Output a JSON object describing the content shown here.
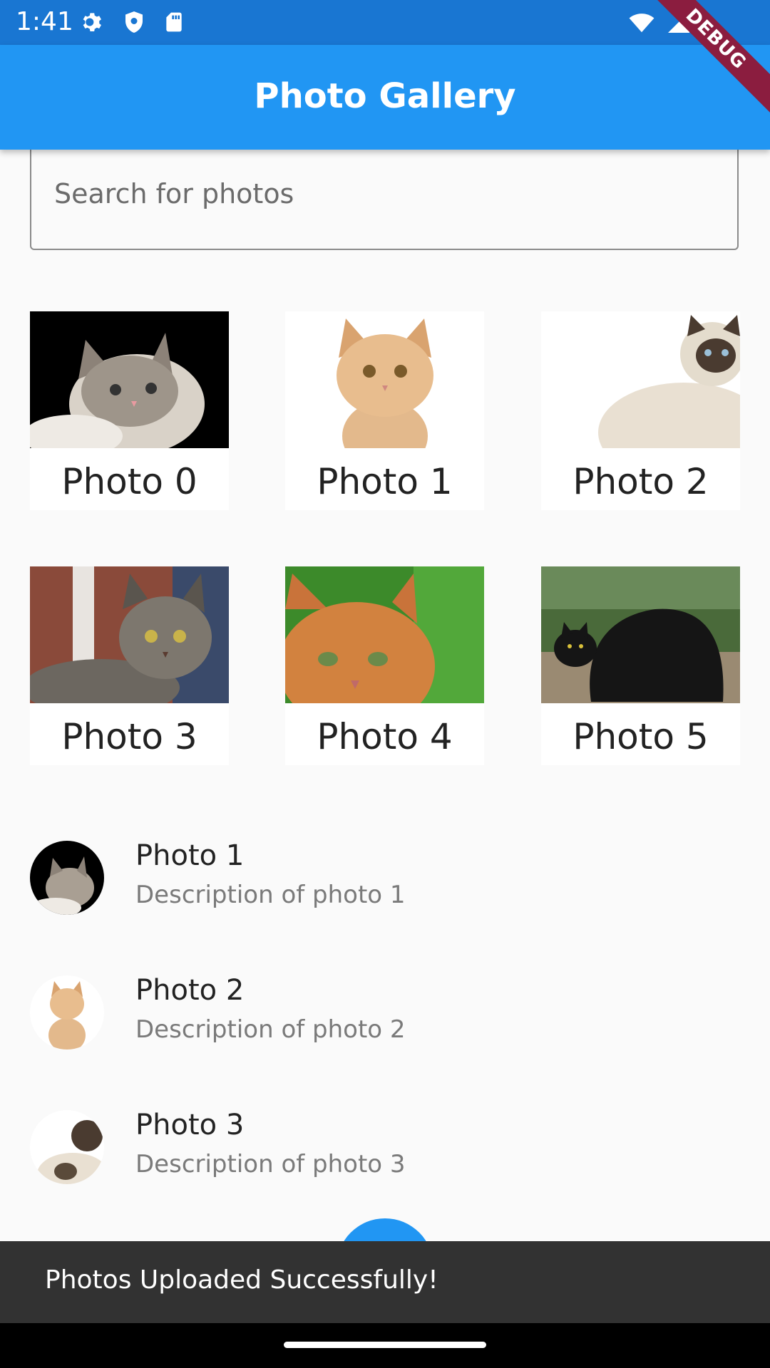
{
  "status_bar": {
    "time": "1:41",
    "icons_left": [
      "gear-icon",
      "shield-icon",
      "sd-card-icon"
    ],
    "icons_right": [
      "wifi-icon",
      "signal-icon"
    ]
  },
  "app_bar": {
    "title": "Photo Gallery",
    "debug_label": "DEBUG"
  },
  "search": {
    "placeholder": "Search for photos"
  },
  "grid": [
    {
      "label": "Photo 0"
    },
    {
      "label": "Photo 1"
    },
    {
      "label": "Photo 2"
    },
    {
      "label": "Photo 3"
    },
    {
      "label": "Photo 4"
    },
    {
      "label": "Photo 5"
    }
  ],
  "list": [
    {
      "title": "Photo 1",
      "subtitle": "Description of photo 1"
    },
    {
      "title": "Photo 2",
      "subtitle": "Description of photo 2"
    },
    {
      "title": "Photo 3",
      "subtitle": "Description of photo 3"
    }
  ],
  "snackbar": {
    "message": "Photos Uploaded Successfully!"
  },
  "colors": {
    "status_bar": "#1976d2",
    "app_bar": "#2196f3",
    "snackbar": "#323232",
    "background": "#fafafa"
  }
}
